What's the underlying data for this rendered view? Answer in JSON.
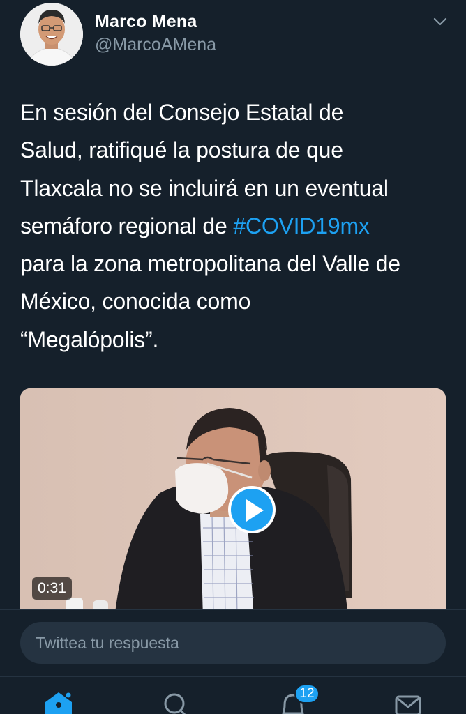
{
  "author": {
    "name": "Marco Mena",
    "handle": "@MarcoAMena"
  },
  "tweet": {
    "lines": [
      "En sesión del Consejo Estatal de",
      "Salud, ratifiqué la postura de que",
      "Tlaxcala no se incluirá en un eventual",
      "semáforo regional de ",
      "para la zona metropolitana del Valle de",
      "México, conocida como",
      "“Megalópolis”."
    ],
    "hashtag": "#COVID19mx"
  },
  "media": {
    "type": "video",
    "duration": "0:31"
  },
  "reply": {
    "placeholder": "Twittea tu respuesta"
  },
  "nav": {
    "items": [
      "home-icon",
      "search-icon",
      "notifications-icon",
      "messages-icon"
    ],
    "notifications_count": "12"
  },
  "colors": {
    "background": "#15202b",
    "accent": "#1da1f2",
    "secondary_text": "#8899a6"
  }
}
